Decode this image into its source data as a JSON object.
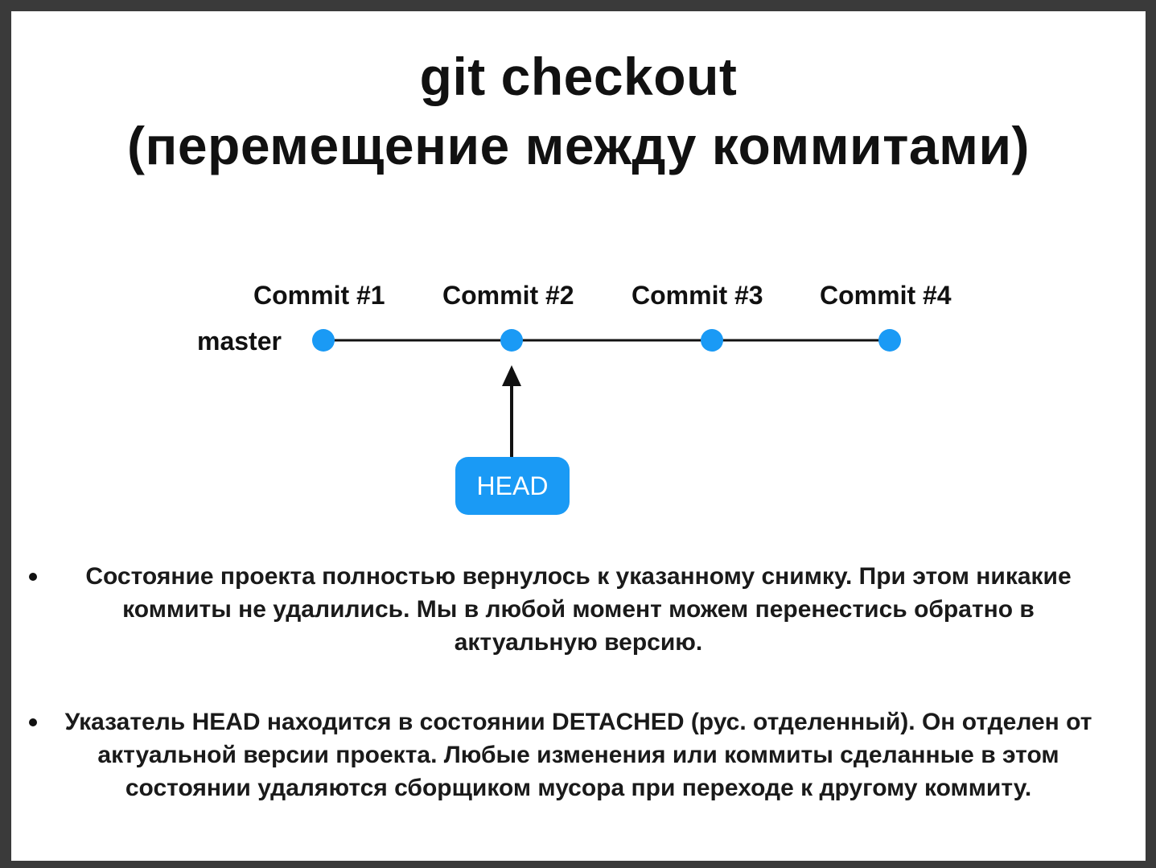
{
  "slide": {
    "title_line1": "git checkout",
    "title_line2": "(перемещение между коммитами)"
  },
  "diagram": {
    "branch": "master",
    "commits": [
      "Commit #1",
      "Commit #2",
      "Commit #3",
      "Commit #4"
    ],
    "head_label": "HEAD",
    "head_points_to": "Commit #2",
    "node_color": "#1a9af5",
    "line_color": "#111111"
  },
  "bullets": [
    "Состояние проекта полностью вернулось к указанному снимку. При этом никакие коммиты не удалились. Мы в любой момент можем перенестись обратно в актуальную версию.",
    "Указатель HEAD находится в состоянии DETACHED (рус. отделенный). Он отделен от актуальной версии проекта. Любые изменения или коммиты сделанные в этом состоянии удаляются сборщиком мусора при переходе к другому коммиту."
  ]
}
